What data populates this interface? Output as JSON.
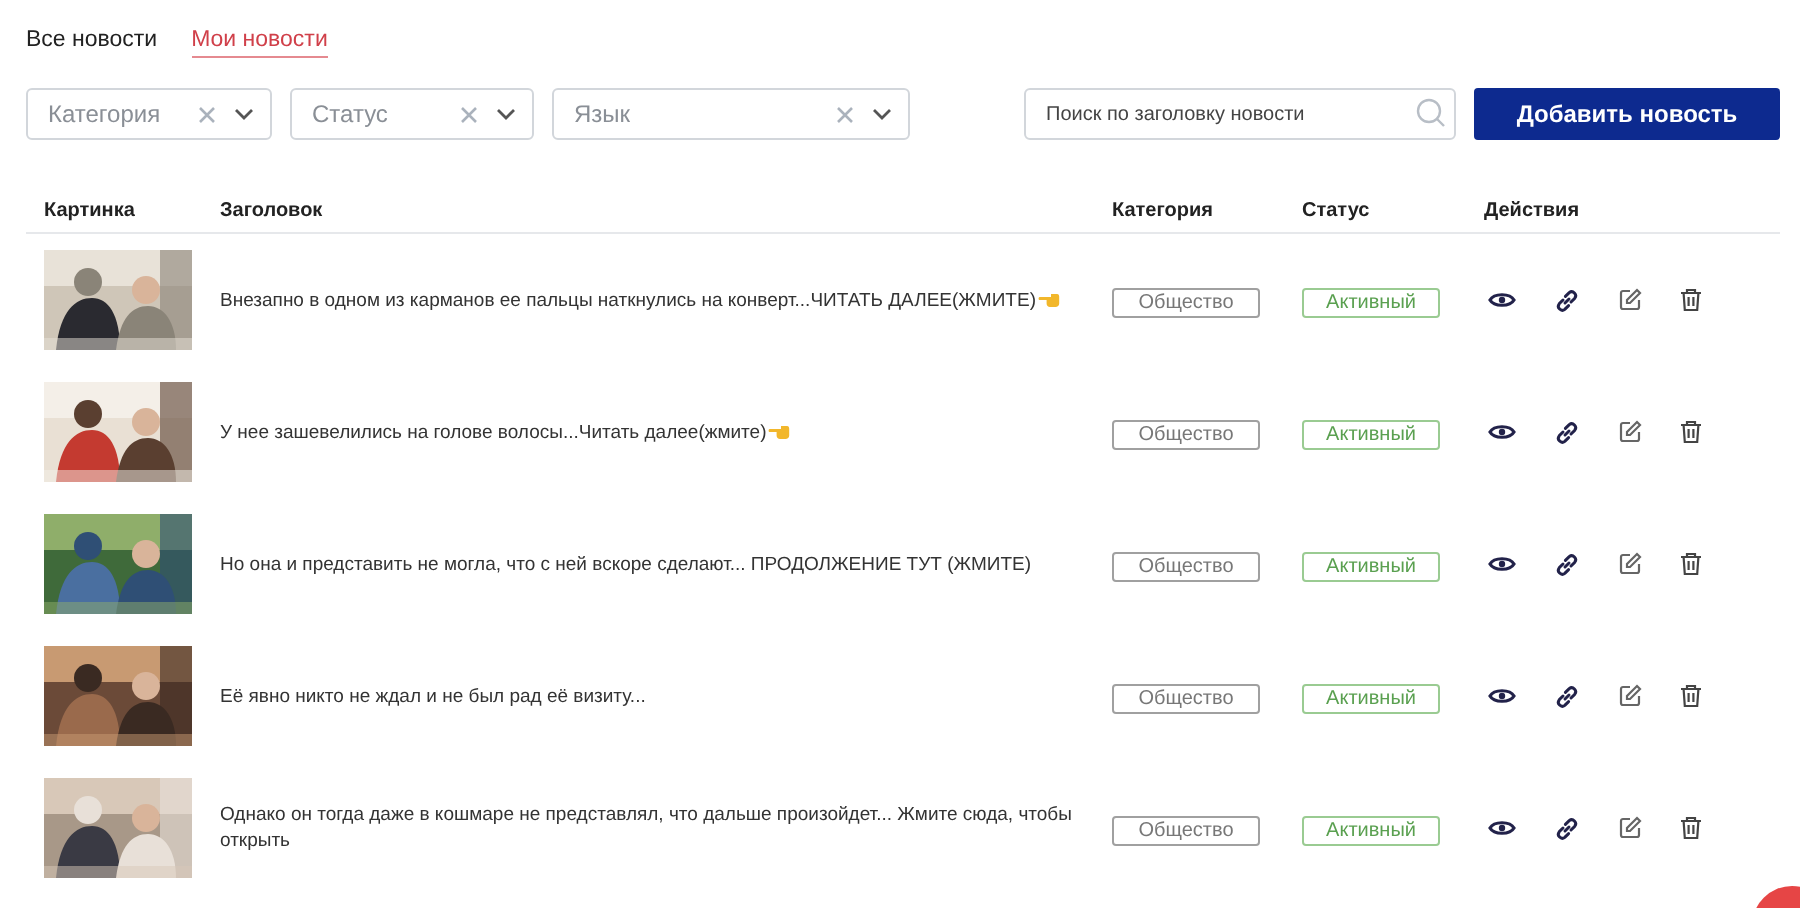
{
  "tabs": [
    {
      "label": "Все новости",
      "selected": false
    },
    {
      "label": "Мои новости",
      "selected": true
    }
  ],
  "filters": [
    {
      "placeholder": "Категория"
    },
    {
      "placeholder": "Статус"
    },
    {
      "placeholder": "Язык"
    }
  ],
  "search": {
    "placeholder": "Поиск по заголовку новости"
  },
  "add_button": "Добавить новость",
  "table": {
    "columns": [
      "Картинка",
      "Заголовок",
      "Категория",
      "Статус",
      "Действия"
    ],
    "rows": [
      {
        "title": "Внезапно в одном из карманов ее пальцы наткнулись на конверт...ЧИТАТЬ ДАЛЕЕ(ЖМИТЕ)",
        "pointer_icon": true,
        "category": "Общество",
        "status": "Активный"
      },
      {
        "title": "У нее зашевелились на голове волосы...Читать далее(жмите)",
        "pointer_icon": true,
        "category": "Общество",
        "status": "Активный"
      },
      {
        "title": "Но она и представить не могла, что с ней вскоре сделают... ПРОДОЛЖЕНИЕ ТУТ (ЖМИТЕ)",
        "pointer_icon": false,
        "category": "Общество",
        "status": "Активный"
      },
      {
        "title": "Её явно никто не ждал и не был рад её визиту...",
        "pointer_icon": false,
        "category": "Общество",
        "status": "Активный"
      },
      {
        "title": "Однако он тогда даже в кошмаре не представлял, что дальше произойдет... Жмите сюда, чтобы открыть",
        "pointer_icon": false,
        "category": "Общество",
        "status": "Активный"
      }
    ]
  },
  "chat_widget": {
    "visible": true
  }
}
